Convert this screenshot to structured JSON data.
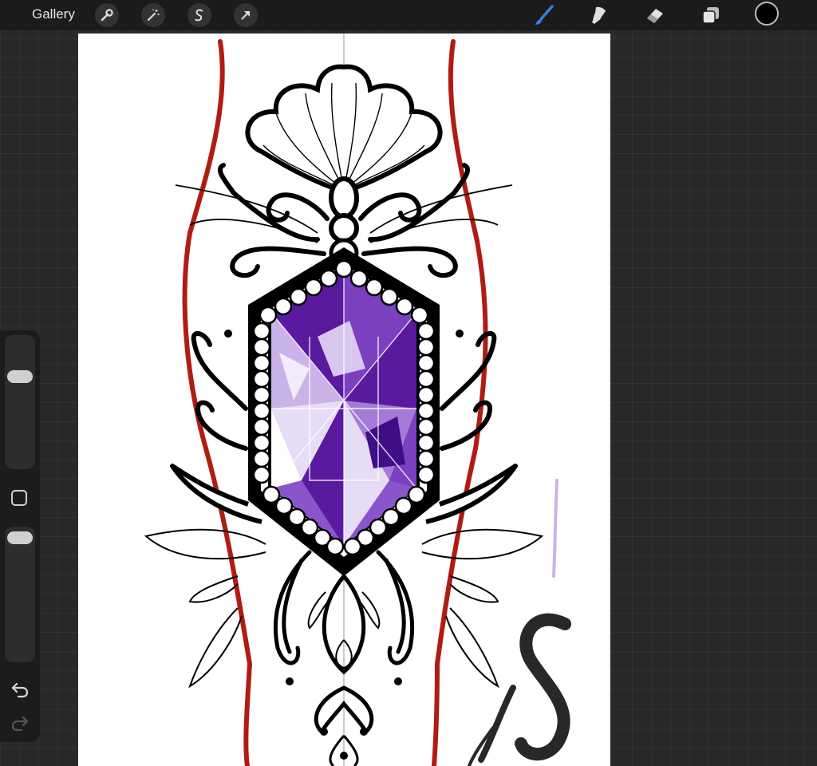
{
  "topbar": {
    "gallery_label": "Gallery",
    "left_tools": [
      "wrench-icon",
      "magic-wand-icon",
      "selection-s-icon",
      "transform-arrow-icon"
    ],
    "right_tools": [
      "brush-icon",
      "smudge-icon",
      "eraser-icon",
      "layers-icon"
    ],
    "active_tool": "brush-icon",
    "active_color": "#000000",
    "accent": "#2f7fe8"
  },
  "sidebar": {
    "controls": [
      "brush-size-slider",
      "modify-button",
      "opacity-slider",
      "undo-icon",
      "redo-icon"
    ]
  },
  "canvas": {
    "background": "#ffffff",
    "palette": {
      "ink": "#000000",
      "guide_red": "#b01c12",
      "gem_dark": "#5a1aa0",
      "gem_mid": "#8a55cc",
      "gem_light": "#e6dcf5"
    }
  }
}
